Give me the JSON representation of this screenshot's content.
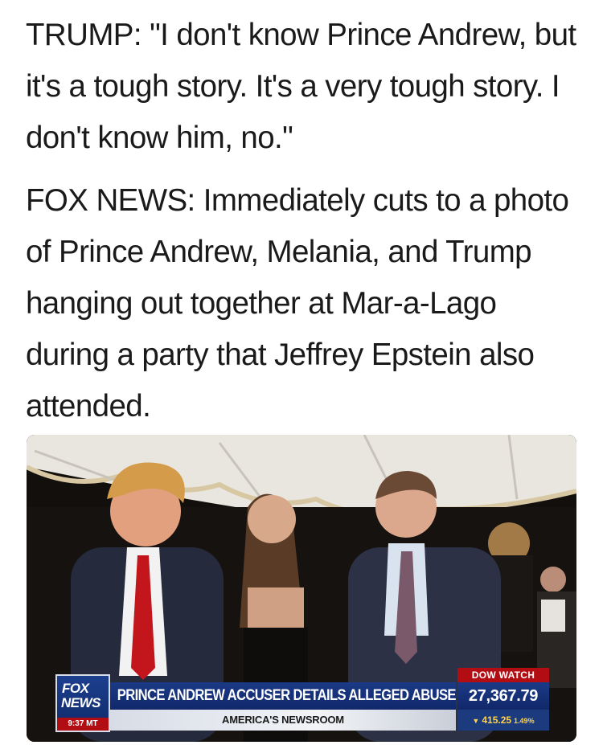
{
  "post": {
    "paragraph_1": "TRUMP: \"I don't know Prince Andrew, but it's a tough story. It's a very tough story. I don't know him, no.\"",
    "paragraph_2": "FOX NEWS: Immediately cuts to a photo of Prince Andrew, Melania, and Trump hanging out together at Mar-a-Lago during a party that Jeffrey Epstein also attended."
  },
  "broadcast": {
    "logo_line_1": "FOX",
    "logo_line_2": "NEWS",
    "time": "9:37 MT",
    "headline": "PRINCE ANDREW ACCUSER DETAILS ALLEGED ABUSE",
    "show_name": "AMERICA'S NEWSROOM",
    "ticker_label": "DOW WATCH",
    "ticker_value": "27,367.79",
    "ticker_change_arrow": "▼",
    "ticker_change": "415.25",
    "ticker_change_pct": "1.49%"
  },
  "colors": {
    "fox_blue": "#1b3a86",
    "fox_red": "#b10d12",
    "ticker_change": "#ffd34d"
  }
}
